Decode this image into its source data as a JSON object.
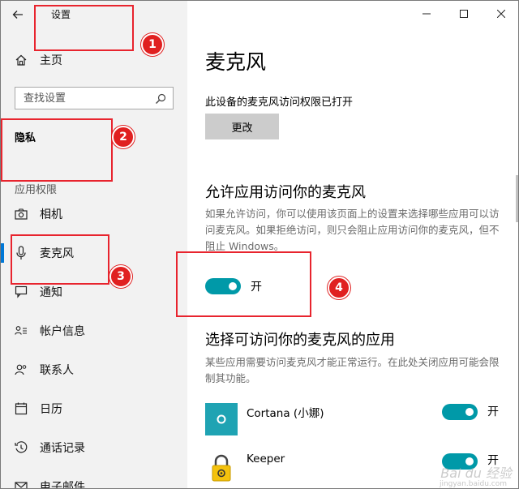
{
  "window": {
    "title": "设置"
  },
  "sidebar": {
    "home_label": "主页",
    "search_placeholder": "查找设置",
    "section_title": "隐私",
    "group_label": "应用权限",
    "items": [
      {
        "label": "相机",
        "icon": "camera-icon"
      },
      {
        "label": "麦克风",
        "icon": "microphone-icon"
      },
      {
        "label": "通知",
        "icon": "notification-icon"
      },
      {
        "label": "帐户信息",
        "icon": "account-info-icon"
      },
      {
        "label": "联系人",
        "icon": "contacts-icon"
      },
      {
        "label": "日历",
        "icon": "calendar-icon"
      },
      {
        "label": "通话记录",
        "icon": "call-history-icon"
      },
      {
        "label": "电子邮件",
        "icon": "email-icon"
      }
    ]
  },
  "main": {
    "title": "麦克风",
    "device_status": "此设备的麦克风访问权限已打开",
    "change_button": "更改",
    "allow_heading": "允许应用访问你的麦克风",
    "allow_desc": "如果允许访问，你可以使用该页面上的设置来选择哪些应用可以访问麦克风。如果拒绝访问，则只会阻止应用访问你的麦克风，但不阻止 Windows。",
    "allow_toggle_text": "开",
    "choose_heading": "选择可访问你的麦克风的应用",
    "choose_desc": "某些应用需要访问麦克风才能正常运行。在此处关闭应用可能会限制其功能。",
    "apps": [
      {
        "name": "Cortana (小娜)",
        "toggle_text": "开",
        "icon_color": "#1fa3b3"
      },
      {
        "name": "Keeper",
        "toggle_text": "开",
        "icon_color": "#f4c20d"
      }
    ]
  },
  "annotations": [
    "1",
    "2",
    "3",
    "4"
  ],
  "colors": {
    "accent": "#0099a8",
    "selection": "#0078d7",
    "annotation": "#e8242e"
  },
  "watermark": {
    "brand": "Bai du 经验",
    "site": "jingyan.baidu.com"
  }
}
